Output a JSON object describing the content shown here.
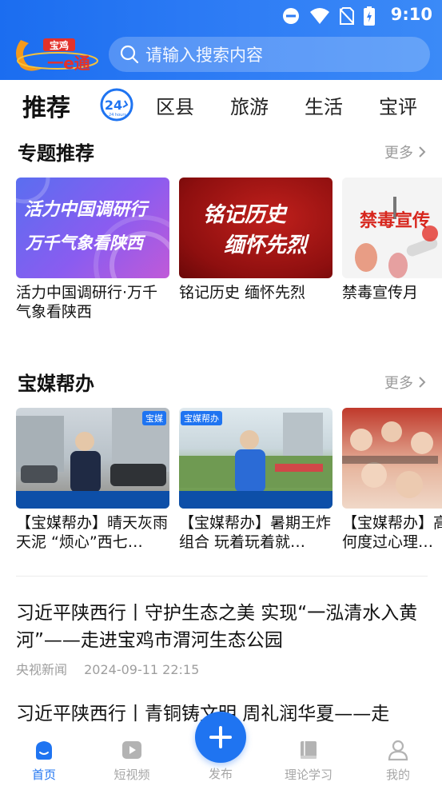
{
  "status_bar": {
    "time": "9:10"
  },
  "header": {
    "logo_text_top": "宝鸡",
    "logo_text_main": "一e通",
    "search_placeholder": "请输入搜索内容"
  },
  "tabs": [
    {
      "label": "推荐",
      "active": true
    },
    {
      "label": "24 hours",
      "icon": "24h-clock-icon"
    },
    {
      "label": "区县"
    },
    {
      "label": "旅游"
    },
    {
      "label": "生活"
    },
    {
      "label": "宝评"
    }
  ],
  "special": {
    "title": "专题推荐",
    "more": "更多",
    "cards": [
      {
        "title": "活力中国调研行·万千气象看陕西",
        "thumb_line1": "活力中国调研行",
        "thumb_line2": "万千气象看陕西"
      },
      {
        "title": "铭记历史 缅怀先烈",
        "thumb_line1": "铭记历史",
        "thumb_line2": "缅怀先烈"
      },
      {
        "title": "禁毒宣传月",
        "thumb_line1": "禁毒宣传"
      }
    ]
  },
  "baomei": {
    "title": "宝媒帮办",
    "more": "更多",
    "cards": [
      {
        "title": "【宝媒帮办】晴天灰雨天泥 “烦心”西七…",
        "badge": "宝媒"
      },
      {
        "title": "【宝媒帮办】暑期王炸组合 玩着玩着就…",
        "badge": "宝媒帮办"
      },
      {
        "title": "【宝媒帮办】高考生如何度过心理…",
        "badge": ""
      }
    ]
  },
  "news": [
    {
      "title": "习近平陕西行丨守护生态之美 实现“一泓清水入黄河”——走进宝鸡市渭河生态公园",
      "source": "央视新闻",
      "time": "2024-09-11 22:15"
    },
    {
      "title": "习近平陕西行丨青铜铸文明 周礼润华夏——走"
    }
  ],
  "bottom_nav": {
    "items": [
      {
        "label": "首页",
        "icon": "home-icon",
        "active": true
      },
      {
        "label": "短视频",
        "icon": "video-icon"
      },
      {
        "label": "发布",
        "icon": "plus-icon"
      },
      {
        "label": "理论学习",
        "icon": "book-icon"
      },
      {
        "label": "我的",
        "icon": "user-icon"
      }
    ]
  },
  "colors": {
    "brand_blue": "#1f74f1",
    "header_blue": "#2f7df5"
  }
}
